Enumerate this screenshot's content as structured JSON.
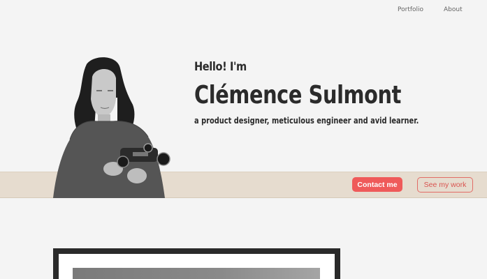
{
  "nav": {
    "portfolio_label": "Portfolio",
    "about_label": "About"
  },
  "hero": {
    "greeting": "Hello! I'm",
    "name": "Clémence Sulmont",
    "tagline": "a product designer, meticulous engineer and avid learner.",
    "photo_icon": "person-holding-model-icon"
  },
  "actions": {
    "contact_label": "Contact me",
    "work_label": "See my work"
  },
  "colors": {
    "accent": "#ef5a5a",
    "band": "#e6dccf",
    "background": "#f4f4f4",
    "text": "#2b2b2b"
  }
}
